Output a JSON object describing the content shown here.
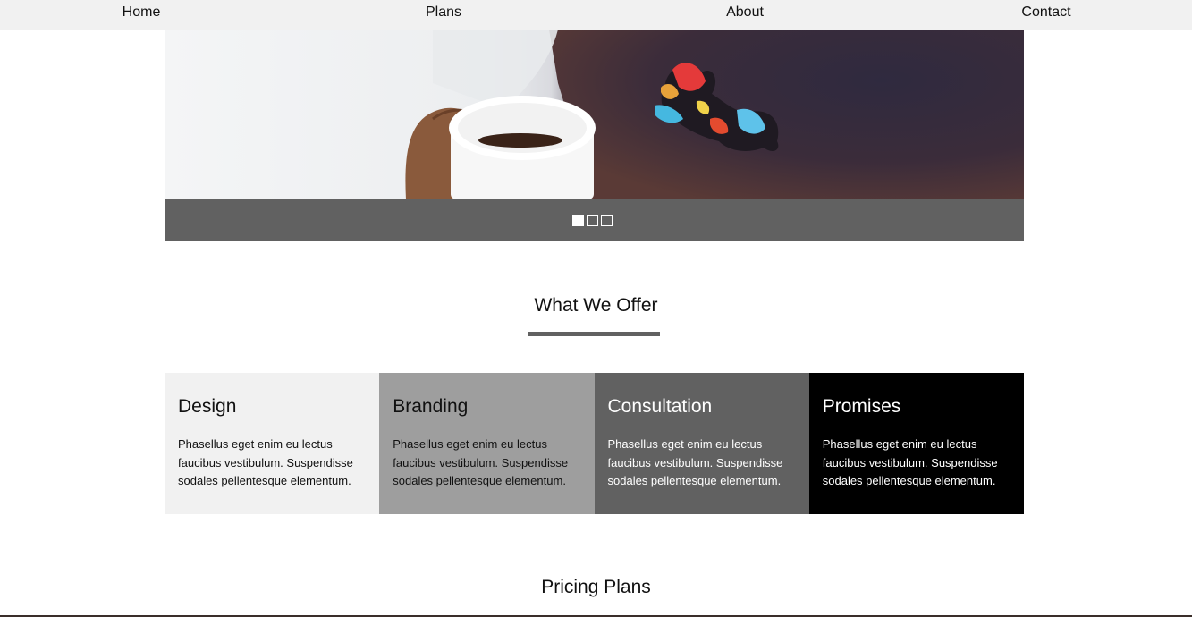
{
  "nav": {
    "items": [
      {
        "label": "Home"
      },
      {
        "label": "Plans"
      },
      {
        "label": "About"
      },
      {
        "label": "Contact"
      }
    ]
  },
  "hero": {
    "image": "coffee-cup-suit-photo",
    "slides_total": 3,
    "active_slide": 1
  },
  "offer": {
    "title": "What We Offer",
    "cards": [
      {
        "title": "Design",
        "text": "Phasellus eget enim eu lectus faucibus vestibulum. Suspendisse sodales pellentesque elementum.",
        "color": "#f1f1f1"
      },
      {
        "title": "Branding",
        "text": "Phasellus eget enim eu lectus faucibus vestibulum. Suspendisse sodales pellentesque elementum.",
        "color": "#9e9e9e"
      },
      {
        "title": "Consultation",
        "text": "Phasellus eget enim eu lectus faucibus vestibulum. Suspendisse sodales pellentesque elementum.",
        "color": "#616161"
      },
      {
        "title": "Promises",
        "text": "Phasellus eget enim eu lectus faucibus vestibulum. Suspendisse sodales pellentesque elementum.",
        "color": "#000000"
      }
    ]
  },
  "pricing": {
    "title": "Pricing Plans"
  }
}
